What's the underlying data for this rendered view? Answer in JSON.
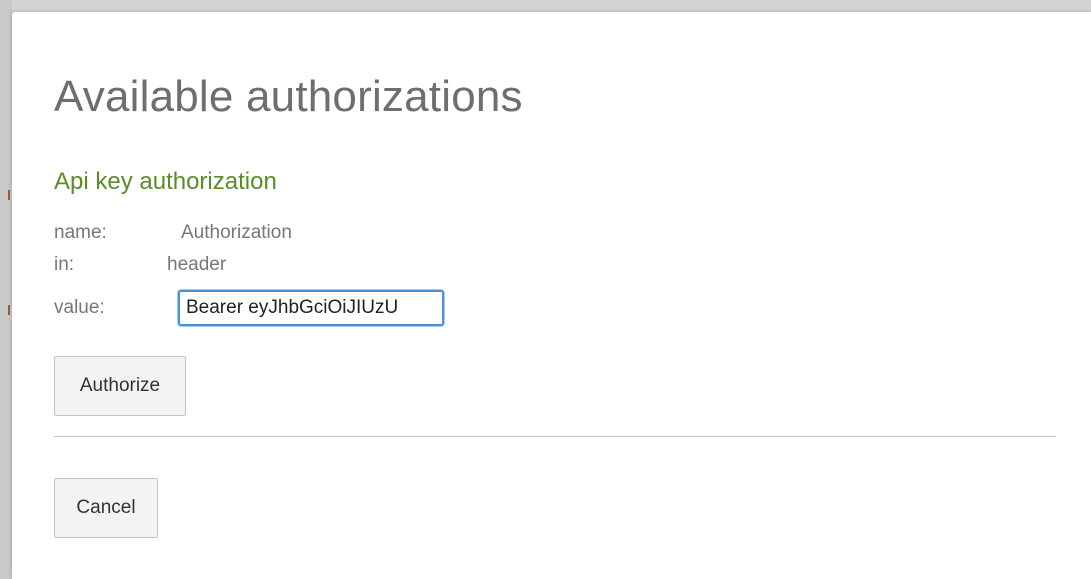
{
  "dialog": {
    "title": "Available authorizations",
    "section_title": "Api key authorization",
    "fields": {
      "name_label": "name:",
      "name_value": "Authorization",
      "in_label": "in:",
      "in_value": "header",
      "value_label": "value:",
      "value_input": "Bearer eyJhbGciOiJIUzU"
    },
    "authorize_label": "Authorize",
    "cancel_label": "Cancel"
  },
  "colors": {
    "title": "#6e6e6e",
    "section_title": "#5b8c2a",
    "input_focus_border": "#4a90d9"
  }
}
